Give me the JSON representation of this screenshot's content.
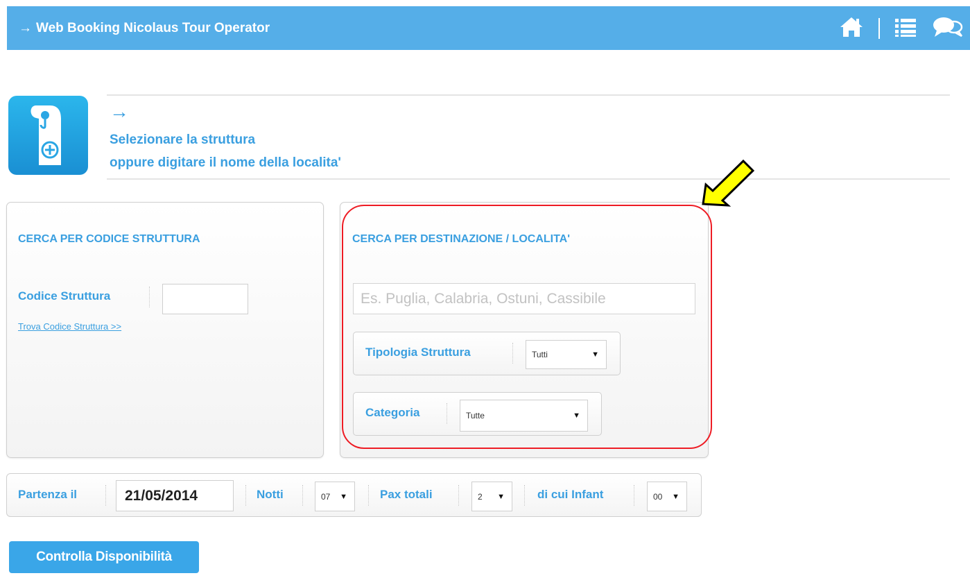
{
  "header": {
    "title": "Web Booking Nicolaus Tour Operator",
    "arrow": "→",
    "icons": [
      "home-icon",
      "list-icon",
      "chat-icon"
    ],
    "color": "#55aee8"
  },
  "intro": {
    "icon": "door-hanger-plus-icon",
    "arrow": "→",
    "line1": "Selezionare la struttura",
    "line2": "oppure digitare il nome della localita'"
  },
  "left_panel": {
    "title": "CERCA PER CODICE STRUTTURA",
    "codice_label": "Codice Struttura",
    "codice_value": "",
    "trova_link": "Trova Codice Struttura >>"
  },
  "right_panel": {
    "title": "CERCA PER DESTINAZIONE / LOCALITA'",
    "destination_placeholder": "Es. Puglia, Calabria, Ostuni, Cassibile",
    "tipologia_label": "Tipologia Struttura",
    "tipologia_value": "Tutti",
    "categoria_label": "Categoria",
    "categoria_value": "Tutte"
  },
  "booking": {
    "partenza_label": "Partenza il",
    "partenza_value": "21/05/2014",
    "notti_label": "Notti",
    "notti_value": "07",
    "pax_label": "Pax totali",
    "pax_value": "2",
    "infant_label": "di cui Infant",
    "infant_value": "00"
  },
  "actions": {
    "check_label": "Controlla Disponibilità"
  },
  "colors": {
    "accent": "#3a9fe0",
    "highlight": "#ee1c24",
    "pointer": "#ffff00"
  }
}
